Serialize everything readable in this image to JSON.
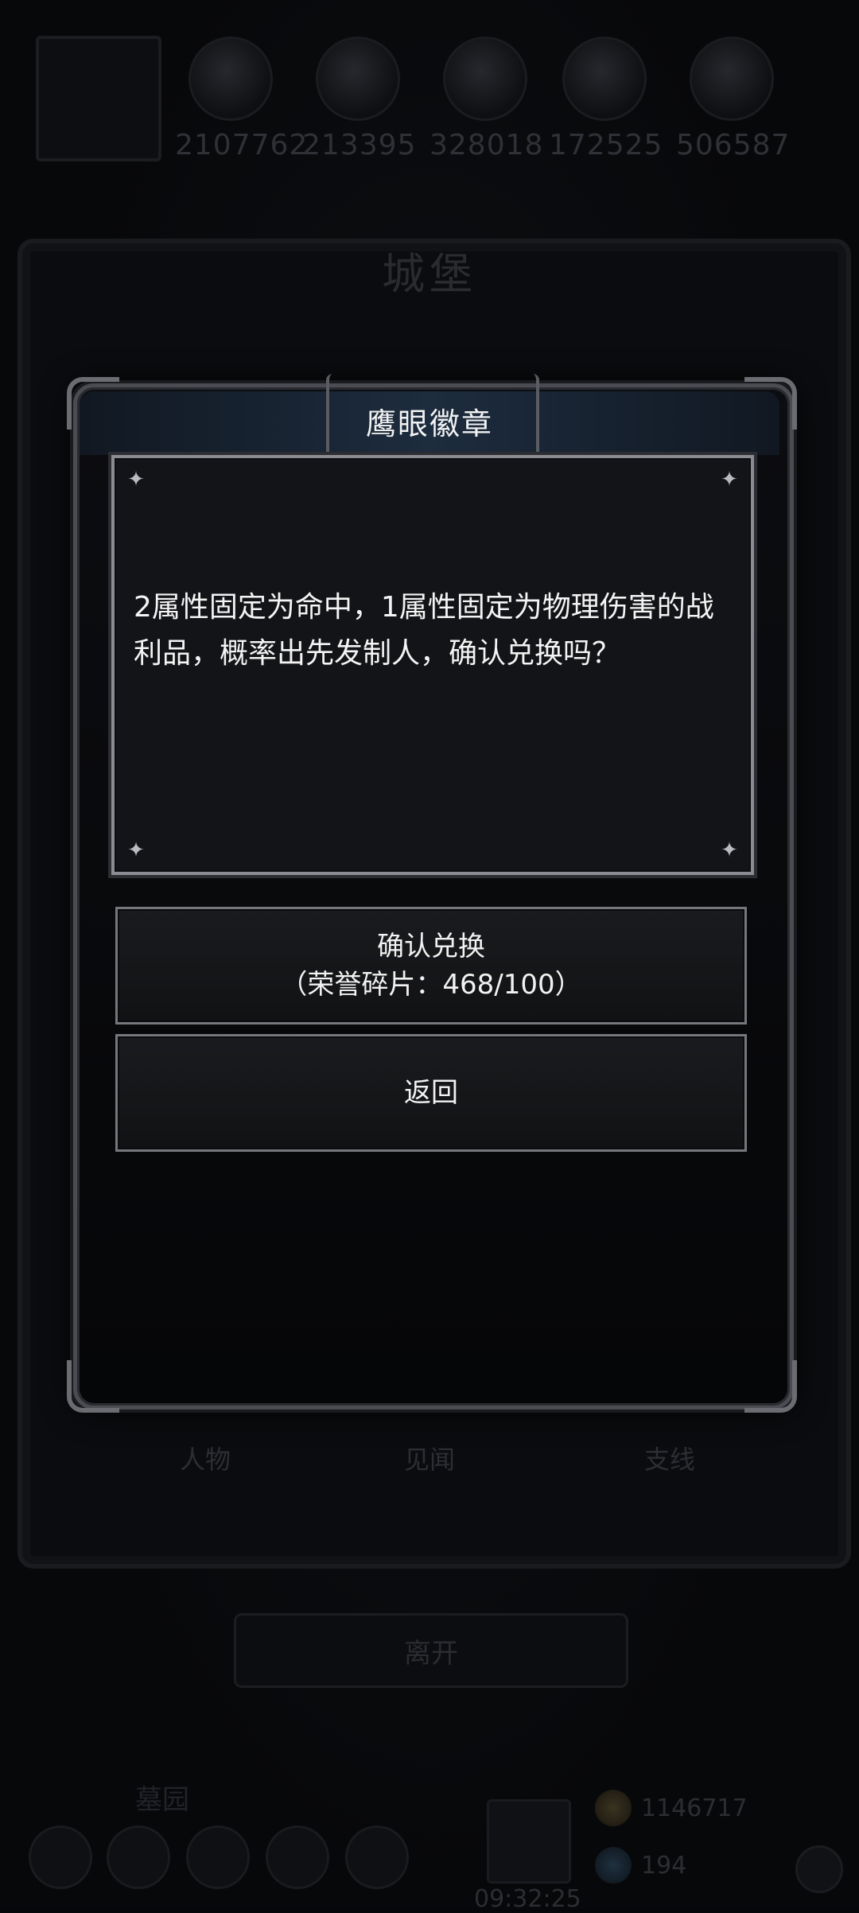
{
  "resources": [
    {
      "icon": "character-emblem-icon"
    },
    {
      "icon": "copper-ore-icon",
      "value": "2107762"
    },
    {
      "icon": "wood-plank-icon",
      "value": "213395"
    },
    {
      "icon": "iron-ingot-icon",
      "value": "328018"
    },
    {
      "icon": "blue-crystal-icon",
      "value": "172525"
    },
    {
      "icon": "silver-ore-icon",
      "value": "506587"
    }
  ],
  "castle": {
    "title": "城堡",
    "tabs": [
      "人物",
      "见闻",
      "支线"
    ]
  },
  "leave_button": "离开",
  "bottom": {
    "location_label": "墓园",
    "clock": "09:32:25",
    "gold": "1146717",
    "gems": "194"
  },
  "dialog": {
    "title": "鹰眼徽章",
    "message": "2属性固定为命中，1属性固定为物理伤害的战利品，概率出先发制人，确认兑换吗？",
    "confirm_label": "确认兑换",
    "confirm_cost": "（荣誉碎片：468/100）",
    "back_label": "返回"
  },
  "colors": {
    "accent_border": "#8a8c92",
    "header_band": "#1d2c3e"
  }
}
